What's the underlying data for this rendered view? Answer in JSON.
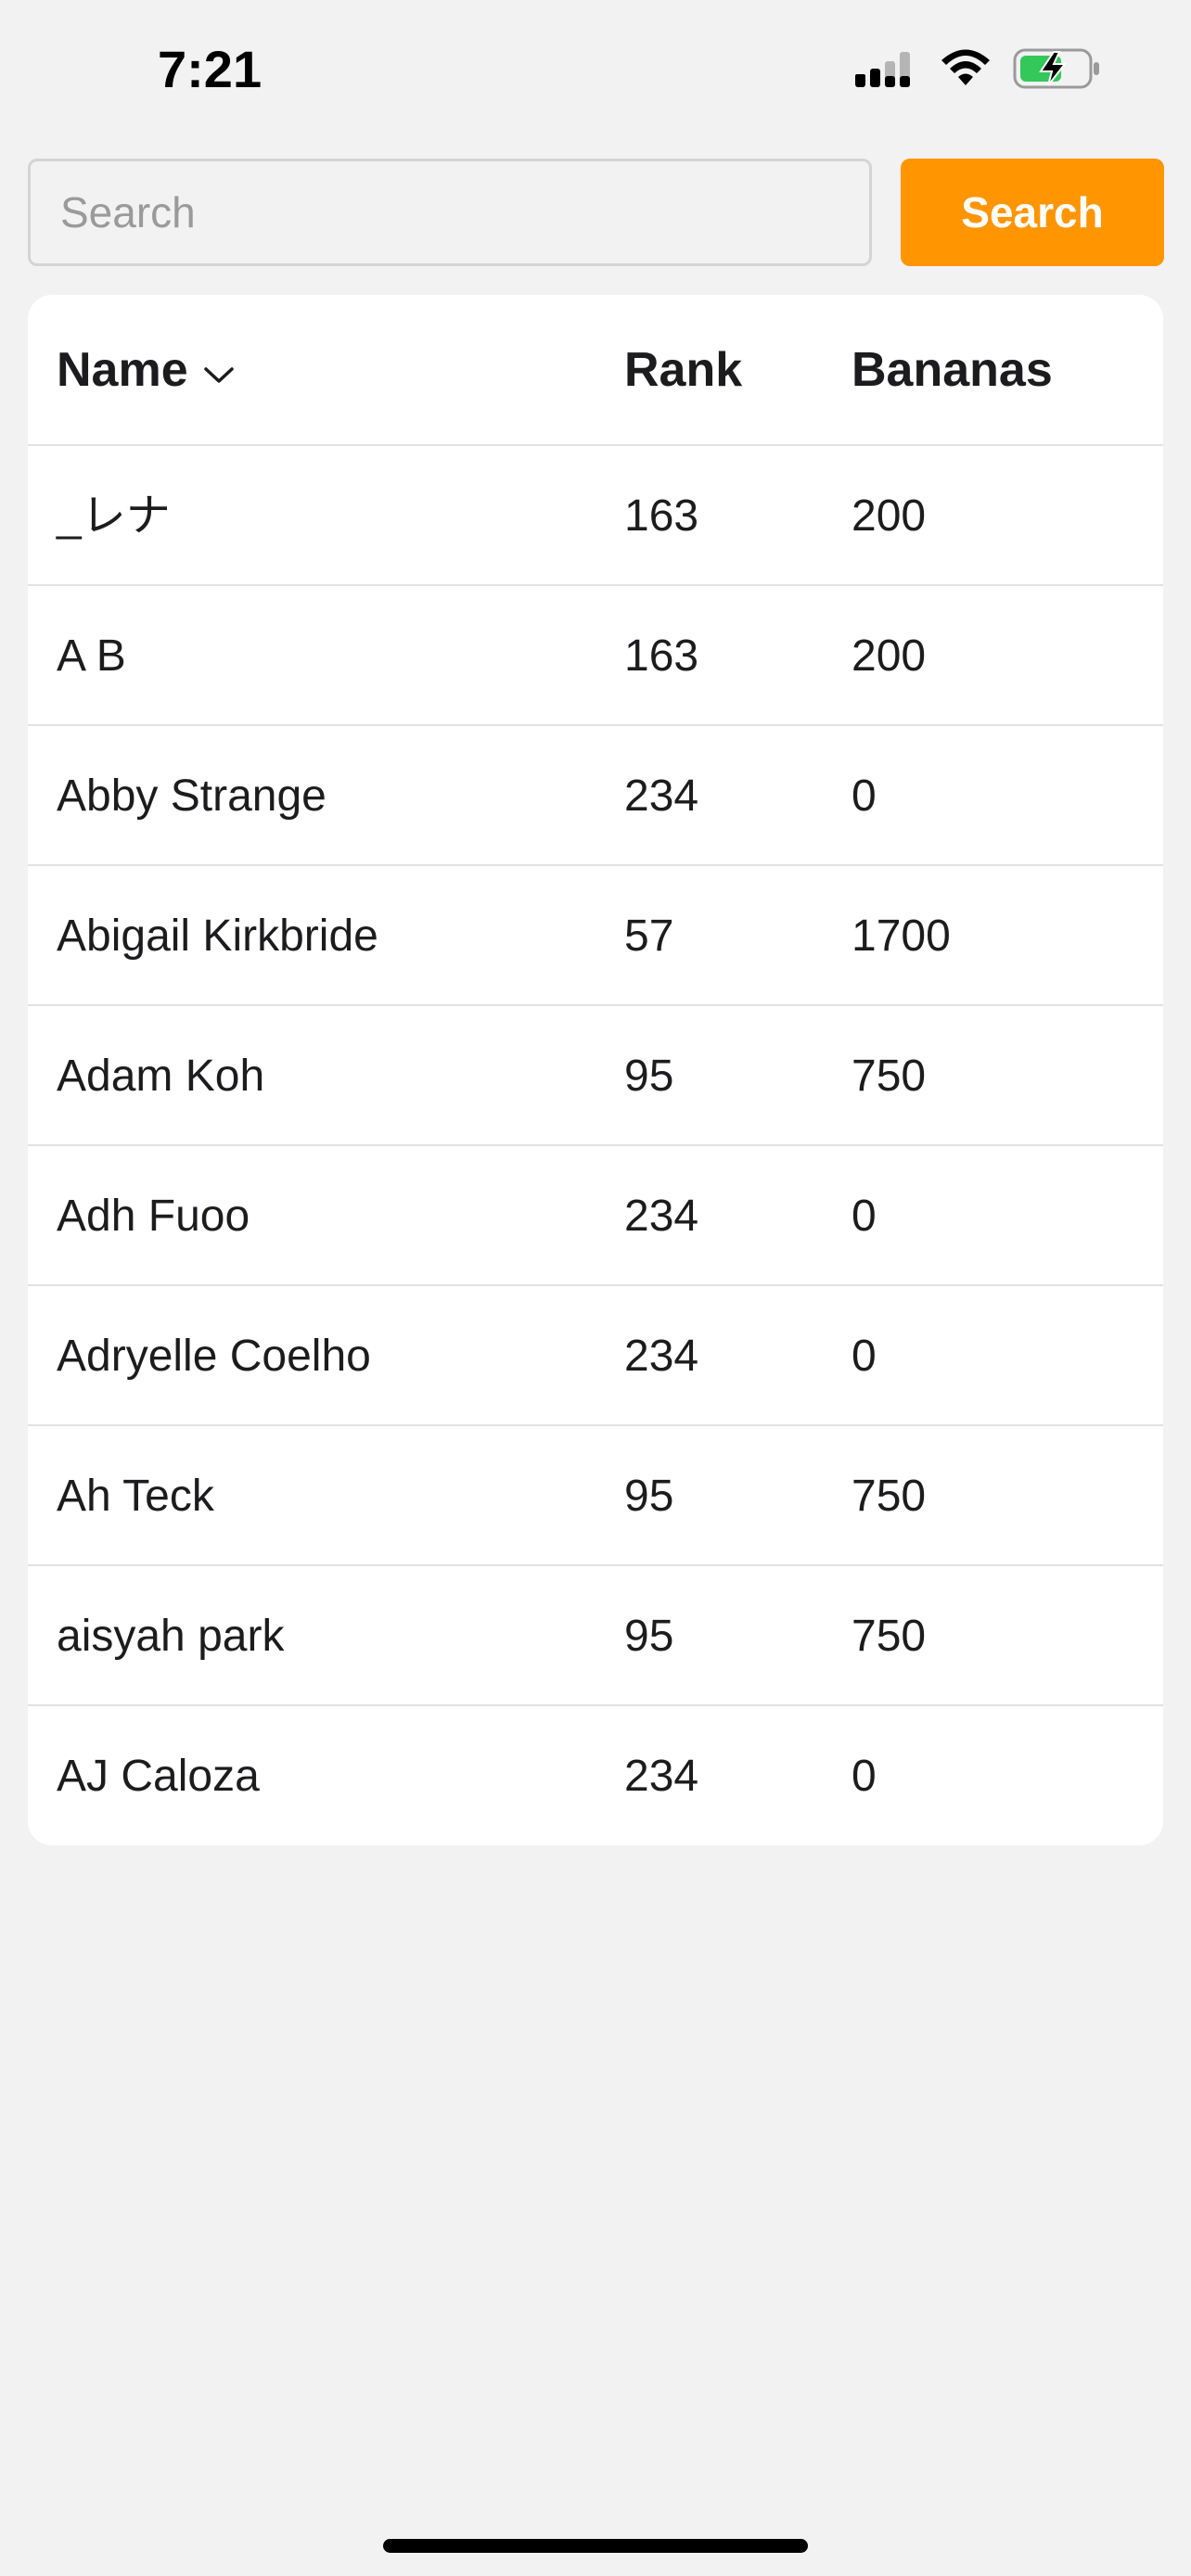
{
  "status_bar": {
    "time": "7:21",
    "icons": [
      "cellular-signal-icon",
      "wifi-icon",
      "battery-charging-icon"
    ],
    "battery_color": "#34c759"
  },
  "search": {
    "placeholder": "Search",
    "value": "",
    "button_label": "Search",
    "button_color": "#ff9500"
  },
  "table": {
    "columns": {
      "name": "Name",
      "rank": "Rank",
      "bananas": "Bananas"
    },
    "sort_icon": "chevron-down-icon",
    "rows": [
      {
        "name": "_レナ",
        "rank": "163",
        "bananas": "200"
      },
      {
        "name": "A B",
        "rank": "163",
        "bananas": "200"
      },
      {
        "name": "Abby Strange",
        "rank": "234",
        "bananas": "0"
      },
      {
        "name": "Abigail Kirkbride",
        "rank": "57",
        "bananas": "1700"
      },
      {
        "name": "Adam Koh",
        "rank": "95",
        "bananas": "750"
      },
      {
        "name": "Adh Fuoo",
        "rank": "234",
        "bananas": "0"
      },
      {
        "name": "Adryelle Coelho",
        "rank": "234",
        "bananas": "0"
      },
      {
        "name": "Ah Teck",
        "rank": "95",
        "bananas": "750"
      },
      {
        "name": "aisyah park",
        "rank": "95",
        "bananas": "750"
      },
      {
        "name": "AJ Caloza",
        "rank": "234",
        "bananas": "0"
      }
    ]
  }
}
